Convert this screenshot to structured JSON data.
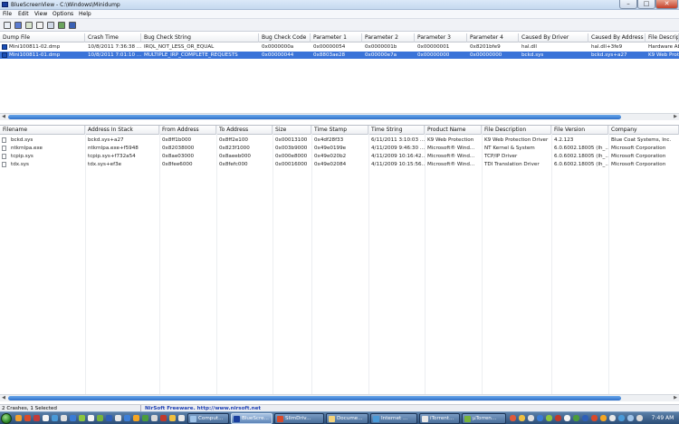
{
  "window": {
    "title": "BlueScreenView - C:\\Windows\\Minidump",
    "min": "–",
    "max": "□",
    "close": "✕"
  },
  "menu": [
    "File",
    "Edit",
    "View",
    "Options",
    "Help"
  ],
  "top_table": {
    "columns": [
      "Dump File",
      "Crash Time",
      "Bug Check String",
      "Bug Check Code",
      "Parameter 1",
      "Parameter 2",
      "Parameter 3",
      "Parameter 4",
      "Caused By Driver",
      "Caused By Address",
      "File Descript"
    ],
    "rows": [
      [
        "Mini100811-02.dmp",
        "10/8/2011 7:36:38 ...",
        "IRQL_NOT_LESS_OR_EQUAL",
        "0x0000000a",
        "0x00000054",
        "0x0000001b",
        "0x00000001",
        "0x8201bfe9",
        "hal.dll",
        "hal.dll+3fe9",
        "Hardware Ab"
      ],
      [
        "Mini100811-01.dmp",
        "10/8/2011 7:01:10 ...",
        "MULTIPLE_IRP_COMPLETE_REQUESTS",
        "0x00000044",
        "0x8803ae28",
        "0x00000e7a",
        "0x00000000",
        "0x00000000",
        "bckd.sys",
        "bckd.sys+a27",
        "K9 Web Prot"
      ]
    ]
  },
  "bottom_table": {
    "columns": [
      "Filename",
      "Address In Stack",
      "From Address",
      "To Address",
      "Size",
      "Time Stamp",
      "Time String",
      "Product Name",
      "File Description",
      "File Version",
      "Company"
    ],
    "rows": [
      [
        "bckd.sys",
        "bckd.sys+a27",
        "0x8ff1b000",
        "0x8ff2e100",
        "0x00013100",
        "0x4df28f33",
        "6/11/2011 3:10:03 ...",
        "K9 Web Protection",
        "K9 Web Protection Driver",
        "4.2.123",
        "Blue Coat Systems, Inc."
      ],
      [
        "ntkrnlpa.exe",
        "ntkrnlpa.exe+f5948",
        "0x82038000",
        "0x823f1000",
        "0x003b9000",
        "0x49e0199e",
        "4/11/2009 9:46:30 ...",
        "Microsoft® Wind...",
        "NT Kernel & System",
        "6.0.6002.18005 (lh_...",
        "Microsoft Corporation"
      ],
      [
        "tcpip.sys",
        "tcpip.sys+f732a54",
        "0x8ae03000",
        "0x8aeeb000",
        "0x000e8000",
        "0x49e020b2",
        "4/11/2009 10:16:42...",
        "Microsoft® Wind...",
        "TCP/IP Driver",
        "6.0.6002.18005 (lh_...",
        "Microsoft Corporation"
      ],
      [
        "tdx.sys",
        "tdx.sys+ef3e",
        "0x8fee6000",
        "0x8fefc000",
        "0x00016000",
        "0x49e02084",
        "4/11/2009 10:15:56...",
        "Microsoft® Wind...",
        "TDI Translation Driver",
        "6.0.6002.18005 (lh_...",
        "Microsoft Corporation"
      ]
    ]
  },
  "status": {
    "count": "2 Crashes, 1 Selected",
    "credit": "NirSoft Freeware.  http://www.nirsoft.net"
  },
  "taskbar": {
    "tasks": [
      "Comput...",
      "BlueScre...",
      "SlimDriv...",
      "Docume...",
      "Internet ...",
      "iTorrent...",
      "µTorren..."
    ],
    "active_index": 1,
    "clock": "7:49 AM"
  },
  "colors": {
    "selection": "#3a73d8",
    "scroll_thumb": "#2e6fc9",
    "taskbar": "#2b4d77"
  }
}
